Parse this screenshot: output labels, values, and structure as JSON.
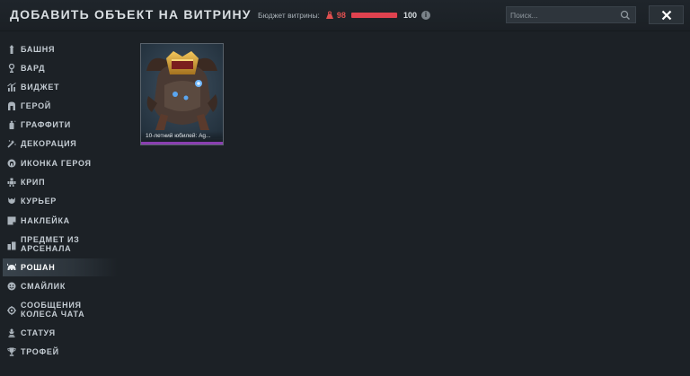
{
  "header": {
    "title": "ДОБАВИТЬ ОБЪЕКТ НА ВИТРИНУ",
    "budget_label": "Бюджет витрины:",
    "budget_current": "98",
    "budget_max": "100",
    "budget_fraction": 0.98,
    "info_glyph": "i",
    "close_glyph": "✕"
  },
  "search": {
    "placeholder": "Поиск..."
  },
  "sidebar": {
    "items": [
      {
        "label": "БАШНЯ",
        "icon": "tower-icon"
      },
      {
        "label": "ВАРД",
        "icon": "ward-icon"
      },
      {
        "label": "ВИДЖЕТ",
        "icon": "widget-icon"
      },
      {
        "label": "ГЕРОЙ",
        "icon": "hero-icon"
      },
      {
        "label": "ГРАФФИТИ",
        "icon": "graffiti-icon"
      },
      {
        "label": "ДЕКОРАЦИЯ",
        "icon": "decoration-icon"
      },
      {
        "label": "ИКОНКА ГЕРОЯ",
        "icon": "hero-icon-icon"
      },
      {
        "label": "КРИП",
        "icon": "creep-icon"
      },
      {
        "label": "КУРЬЕР",
        "icon": "courier-icon"
      },
      {
        "label": "НАКЛЕЙКА",
        "icon": "sticker-icon"
      },
      {
        "label": "ПРЕДМЕТ ИЗ АРСЕНАЛА",
        "icon": "arsenal-icon"
      },
      {
        "label": "РОШАН",
        "icon": "roshan-icon"
      },
      {
        "label": "СМАЙЛИК",
        "icon": "emoticon-icon"
      },
      {
        "label": "СООБЩЕНИЯ КОЛЕСА ЧАТА",
        "icon": "chat-wheel-icon"
      },
      {
        "label": "СТАТУЯ",
        "icon": "statue-icon"
      },
      {
        "label": "ТРОФЕЙ",
        "icon": "trophy-icon"
      }
    ],
    "active_index": 11
  },
  "items": [
    {
      "caption": "10-летний юбилей: Ag...",
      "rarity_color": "#8a3fb0"
    }
  ],
  "colors": {
    "background": "#1c2126",
    "budget_red": "#e0424f",
    "rarity_mythical": "#8a3fb0"
  }
}
